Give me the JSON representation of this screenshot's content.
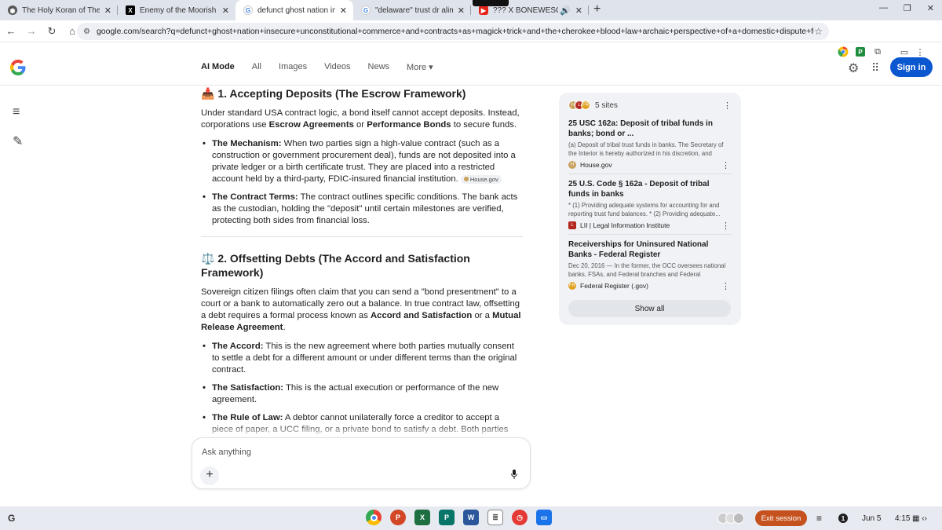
{
  "browser": {
    "tabs": [
      {
        "title": "The Holy Koran of The Moorish",
        "favicon": "globe-icon",
        "active": false
      },
      {
        "title": "Enemy of the Moorish Nation,",
        "favicon": "x-logo-icon",
        "active": false
      },
      {
        "title": "defunct ghost nation insecure",
        "favicon": "google-icon",
        "active": true
      },
      {
        "title": "\"delaware\" trust dr alim bey - G",
        "favicon": "google-icon",
        "active": false
      },
      {
        "title": "??? X BONEWESO - \"CRESC",
        "favicon": "youtube-icon",
        "active": false
      }
    ],
    "url": "google.com/search?q=defunct+ghost+nation+insecure+unconstitutional+commerce+and+contracts+as+magick+trick+and+the+cherokee+blood+law+archaic+perspective+of+a+domestic+dispute+founded+in+this+magick+trick.+a..."
  },
  "google": {
    "logo": "G",
    "nav": [
      "AI Mode",
      "All",
      "Images",
      "Videos",
      "News",
      "More ▾"
    ],
    "signin": "Sign in"
  },
  "answer": {
    "s1_emoji": "📥",
    "s1_title": "1. Accepting Deposits (The Escrow Framework)",
    "s1_p": {
      "a": "Under standard USA contract logic, a bond itself cannot accept deposits. Instead, corporations use ",
      "b": "Escrow Agreements",
      "c": " or ",
      "d": "Performance Bonds",
      "e": " to secure funds."
    },
    "s1_b1": {
      "label": "The Mechanism:",
      "text": " When two parties sign a high-value contract (such as a construction or government procurement deal), funds are not deposited into a private ledger or a birth certificate trust. They are placed into a restricted account held by a third-party, FDIC-insured financial institution.",
      "cite": "House.gov"
    },
    "s1_b2": {
      "label": "The Contract Terms:",
      "text": " The contract outlines specific conditions. The bank acts as the custodian, holding the \"deposit\" until certain milestones are verified, protecting both sides from financial loss."
    },
    "s2_emoji": "⚖️",
    "s2_title": "2. Offsetting Debts (The Accord and Satisfaction Framework)",
    "s2_p": {
      "a": "Sovereign citizen filings often claim that you can send a \"bond presentment\" to a court or a bank to automatically zero out a balance. In true contract law, offsetting a debt requires a formal process known as ",
      "b": "Accord and Satisfaction",
      "c": " or a ",
      "d": "Mutual Release Agreement",
      "e": "."
    },
    "s2_b1": {
      "label": "The Accord:",
      "text": " This is the new agreement where both parties mutually consent to settle a debt for a different amount or under different terms than the original contract."
    },
    "s2_b2": {
      "label": "The Satisfaction:",
      "text": " This is the actual execution or performance of the new agreement."
    },
    "s2_b3": {
      "label": "The Rule of Law:",
      "text": " A debtor cannot unilaterally force a creditor to accept a piece of paper, a UCC filing, or a private bond to satisfy a debt. Both parties must sign a legally binding contract acknowledging that the debt has been paid and the account is settled."
    }
  },
  "sources": {
    "count": "5 sites",
    "items": [
      {
        "title": "25 USC 162a: Deposit of tribal funds in banks; bond or ...",
        "desc": "(a) Deposit of tribal trust funds in banks. The Secretary of the Interior is hereby authorized in his discretion, and unde...",
        "site": "House.gov",
        "color": "#c9a25d"
      },
      {
        "title": "25 U.S. Code § 162a - Deposit of tribal funds in banks",
        "desc": "* (1) Providing adequate systems for accounting for and reporting trust fund balances. * (2) Providing adequate...",
        "site": "LII | Legal Information Institute",
        "color": "#b3261e"
      },
      {
        "title": "Receiverships for Uninsured National Banks - Federal Register",
        "desc": "Dec 20, 2016 — In the former, the OCC oversees national banks, FSAs, and Federal branches and Federal agencies,...",
        "site": "Federal Register (.gov)",
        "color": "#e0a020"
      }
    ],
    "show_all": "Show all"
  },
  "ask": {
    "placeholder": "Ask anything"
  },
  "shelf": {
    "launcher": "G",
    "exit": "Exit session",
    "date": "Jun 5",
    "time": "4:15"
  }
}
